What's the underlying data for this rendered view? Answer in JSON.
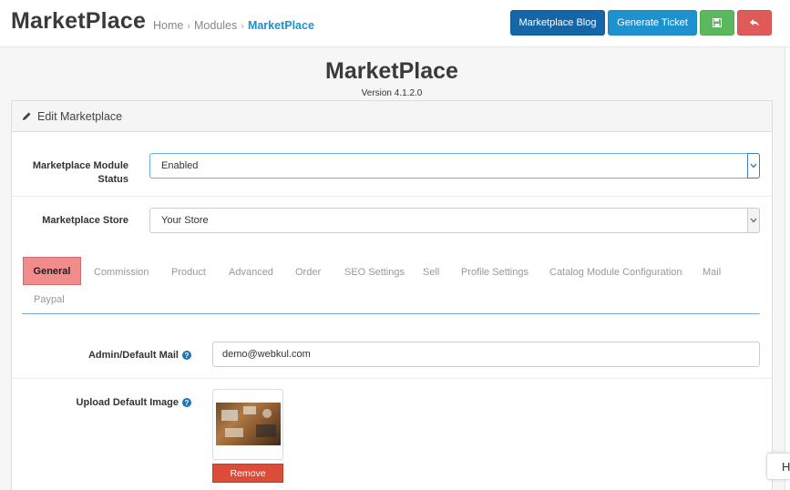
{
  "header": {
    "title": "MarketPlace",
    "breadcrumb": [
      "Home",
      "Modules",
      "MarketPlace"
    ],
    "buttons": {
      "blog": "Marketplace Blog",
      "ticket": "Generate Ticket"
    },
    "colors": {
      "blog": "#1565a9",
      "ticket": "#1e91cf",
      "save": "#5cb85c",
      "back": "#e05a5a"
    }
  },
  "module": {
    "title": "MarketPlace",
    "version": "Version 4.1.2.0"
  },
  "panel": {
    "heading": "Edit Marketplace",
    "status_label_1": "Marketplace Module",
    "status_label_2": "Status",
    "status_value": "Enabled",
    "store_label": "Marketplace Store",
    "store_value": "Your Store"
  },
  "tabs": [
    "General",
    "Commission",
    "Product",
    "Advanced",
    "Order",
    "SEO Settings",
    "Sell",
    "Profile Settings",
    "Catalog Module Configuration",
    "Mail",
    "Paypal"
  ],
  "general": {
    "mail_label": "Admin/Default Mail",
    "mail_value": "demo@webkul.com",
    "image_label": "Upload Default Image",
    "remove_label": "Remove"
  },
  "side_tab_letter": "H"
}
